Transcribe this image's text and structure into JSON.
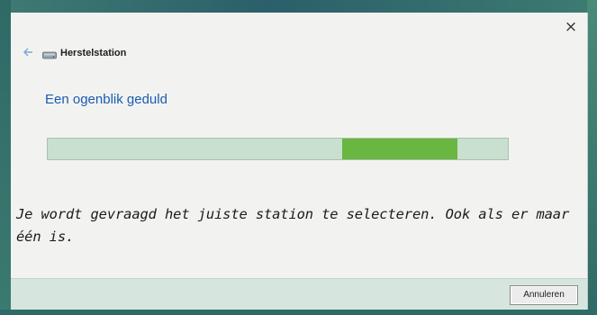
{
  "window": {
    "close_glyph": "×"
  },
  "header": {
    "back_icon": "back-arrow-icon",
    "drive_icon": "drive-icon",
    "title": "Herstelstation"
  },
  "main": {
    "heading": "Een ogenblik geduld",
    "progress": {
      "indeterminate": true,
      "segment_start_fraction": 0.64,
      "segment_width_fraction": 0.25,
      "track_color": "#c9dfcf",
      "fill_color": "#69b640"
    }
  },
  "caption": "Je wordt gevraagd het juiste station te selecteren. Ook als er maar één is.",
  "footer": {
    "cancel_label": "Annuleren"
  },
  "colors": {
    "accent_blue": "#1b5bb0",
    "dialog_bg": "#f2f3f1",
    "footer_bg": "#d6e6de"
  }
}
